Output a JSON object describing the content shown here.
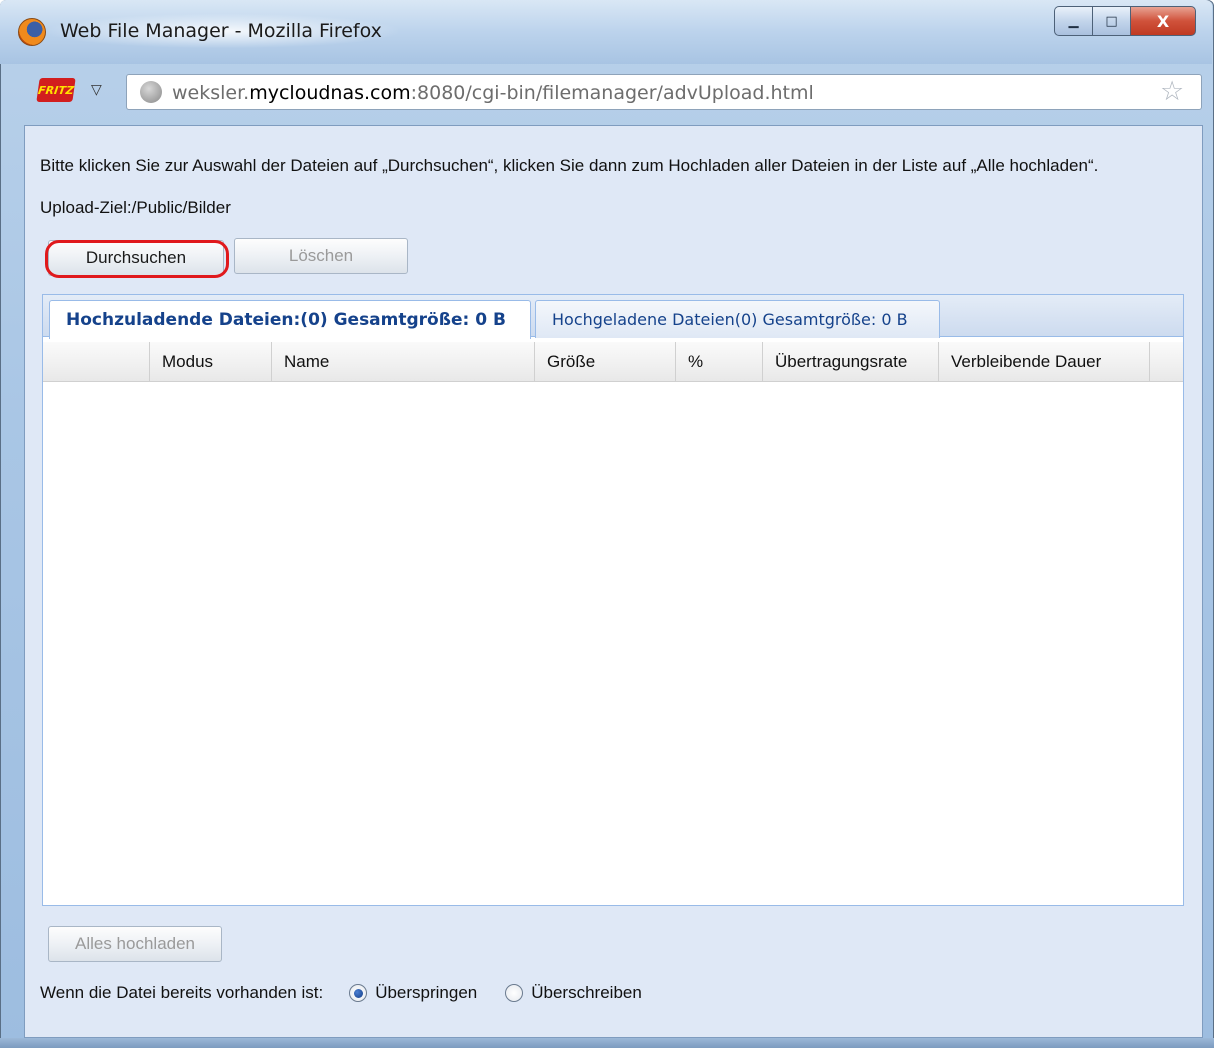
{
  "window": {
    "title": "Web File Manager - Mozilla Firefox",
    "minimize_label": "▁",
    "maximize_label": "□",
    "close_label": "X"
  },
  "navbar": {
    "fritz_label": "FRITZ",
    "dropmarker": "▽",
    "url_prefix": "weksler.",
    "url_host": "mycloudnas.com",
    "url_rest": ":8080/cgi-bin/filemanager/advUpload.html",
    "bookmark_star": "☆"
  },
  "upload": {
    "instructions": "Bitte klicken Sie zur Auswahl der Dateien auf „Durchsuchen“, klicken Sie dann zum Hochladen aller Dateien in der Liste auf „Alle hochladen“.",
    "target": "Upload-Ziel:/Public/Bilder",
    "browse_label": "Durchsuchen",
    "delete_label": "Löschen"
  },
  "tabs": [
    {
      "label": "Hochzuladende Dateien:(0) Gesamtgröße: 0 B",
      "active": true
    },
    {
      "label": "Hochgeladene Dateien(0) Gesamtgröße: 0 B",
      "active": false
    }
  ],
  "grid": {
    "columns": [
      "",
      "Modus",
      "Name",
      "Größe",
      "%",
      "Übertragungsrate",
      "Verbleibende Dauer"
    ],
    "rows": []
  },
  "footer": {
    "upload_all_label": "Alles hochladen",
    "exists_label": "Wenn die Datei bereits vorhanden ist:",
    "options": [
      {
        "label": "Überspringen",
        "checked": true
      },
      {
        "label": "Überschreiben",
        "checked": false
      }
    ]
  },
  "icons": {
    "browser": "firefox-icon",
    "site": "fritz-icon",
    "security": "globe-icon",
    "bookmark": "star-icon"
  },
  "colors": {
    "highlight": "#e0191c",
    "tab_text": "#15428b"
  }
}
